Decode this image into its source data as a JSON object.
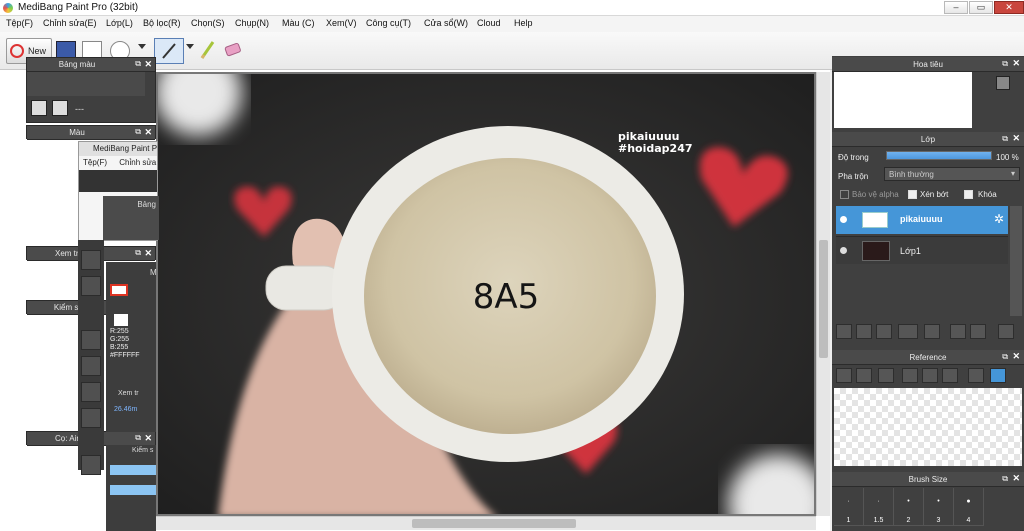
{
  "window": {
    "title": "MediBang Paint Pro (32bit)",
    "minimize": "–",
    "maximize": "▭",
    "close": "✕"
  },
  "menu": [
    "Tệp(F)",
    "Chỉnh sửa(E)",
    "Lớp(L)",
    "Bộ lọc(R)",
    "Chọn(S)",
    "Chụp(N)",
    "Màu (C)",
    "Xem(V)",
    "Công cụ(T)",
    "Cửa sổ(W)",
    "Cloud",
    "Help"
  ],
  "toolbar": {
    "new_label": "New"
  },
  "panels": {
    "palette": {
      "title": "Bảng màu",
      "empty": "---"
    },
    "color": {
      "title": "Màu"
    },
    "preview": {
      "title": "Xem trước ca"
    },
    "control": {
      "title": "Kiểm soát cọ"
    },
    "brush": {
      "title": "Cọ: Airbrush"
    }
  },
  "nested_window": {
    "title": "MediBang Paint Pro",
    "menu": [
      "Tệp(F)",
      "Chỉnh sửa"
    ],
    "panel_bang": "Bảng",
    "panel_m": "M",
    "color_values": {
      "r": "R:255",
      "g": "G:255",
      "b": "B:255",
      "hex": "#FFFFFF"
    },
    "panel_xem": "Xem tr",
    "coord": "26.46m",
    "panel_kiem": "Kiểm s"
  },
  "canvas": {
    "watermark_line1": "pikaiuuuu",
    "watermark_line2": "#hoidap247",
    "cup_text": "8A5",
    "colors": {
      "heart": "#e1343f",
      "cup": "#ecebe6",
      "background": "#2b2b2b"
    }
  },
  "right_dock": {
    "navigator": {
      "title": "Hoa tiêu"
    },
    "layers": {
      "title": "Lớp",
      "opacity_label": "Độ trong",
      "opacity_value": "100 %",
      "opacity_fraction": 1.0,
      "blend_label": "Pha trộn",
      "blend_value": "Bình thường",
      "protect_alpha": "Bảo vệ alpha",
      "clipping": "Xén bớt",
      "lock": "Khóa",
      "items": [
        {
          "name": "pikaiuuuu",
          "selected": true
        },
        {
          "name": "Lớp1",
          "selected": false
        }
      ]
    },
    "reference": {
      "title": "Reference"
    },
    "brush_size": {
      "title": "Brush Size",
      "sizes": [
        "1",
        "1.5",
        "2",
        "3",
        "4"
      ]
    }
  }
}
